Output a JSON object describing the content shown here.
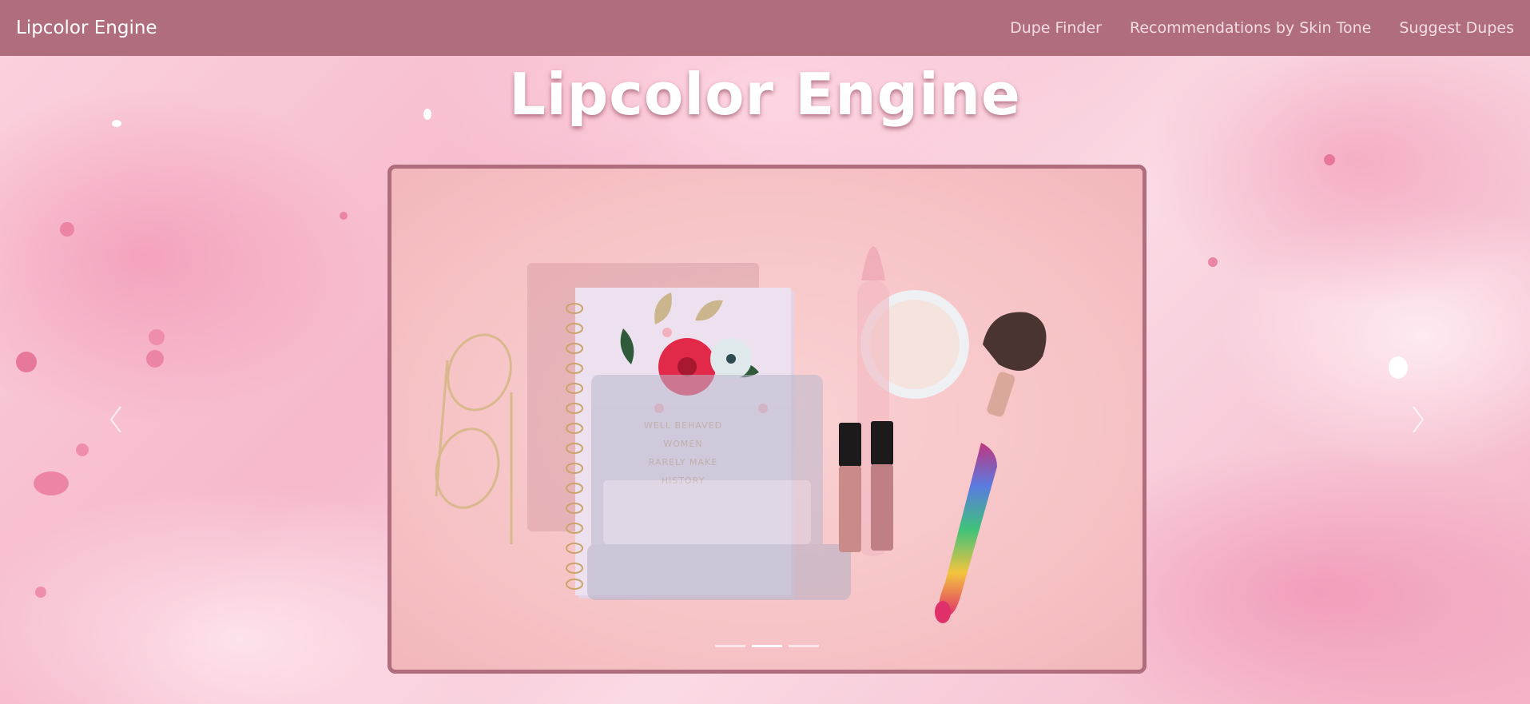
{
  "navbar": {
    "brand": "Lipcolor Engine",
    "links": [
      {
        "label": "Dupe Finder"
      },
      {
        "label": "Recommendations by Skin Tone"
      },
      {
        "label": "Suggest Dupes"
      }
    ]
  },
  "hero": {
    "title": "Lipcolor Engine"
  },
  "carousel": {
    "slide_count": 3,
    "active_index": 1,
    "notebook_text": [
      "WELL BEHAVED",
      "WOMEN",
      "RARELY MAKE",
      "HISTORY"
    ]
  },
  "icons": {
    "prev": "chevron-left-icon",
    "next": "chevron-right-icon"
  },
  "colors": {
    "navbar": "#b06d7e",
    "frame_border": "#b06d7e",
    "background": "#f7c3d2",
    "text_light": "#ffffff"
  }
}
